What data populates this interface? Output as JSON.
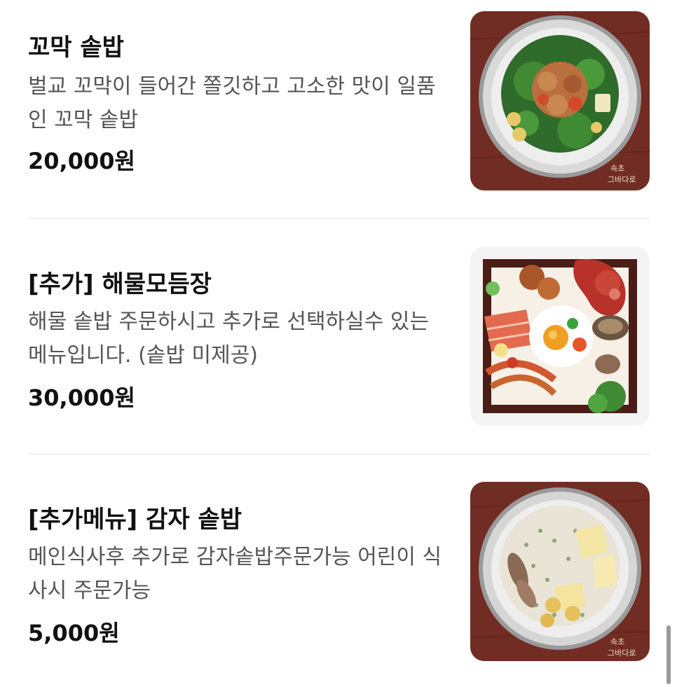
{
  "menu": {
    "items": [
      {
        "title": "꼬막 솥밥",
        "description": "벌교 꼬막이 들어간 쫄깃하고 고소한 맛이 일품인 꼬막 솥밥",
        "price": "20,000원",
        "image_icon": "cockle-rice-pot-photo"
      },
      {
        "title": "[추가] 해물모듬장",
        "description": "해물 솥밥 주문하시고 추가로 선택하실수 있는 메뉴입니다. (솥밥 미제공)",
        "price": "30,000원",
        "image_icon": "seafood-platter-photo"
      },
      {
        "title": "[추가메뉴] 감자 솥밥",
        "description": "메인식사후 추가로 감자솥밥주문가능 어린이 식사시 주문가능",
        "price": "5,000원",
        "image_icon": "potato-rice-pot-photo"
      }
    ]
  },
  "photo_watermark": "속초 그바다로",
  "colors": {
    "title": "#111111",
    "description": "#555555",
    "divider": "#f0f0f0",
    "table_wood": "#6b2a22",
    "pot_metal": "#c8c8c8"
  }
}
